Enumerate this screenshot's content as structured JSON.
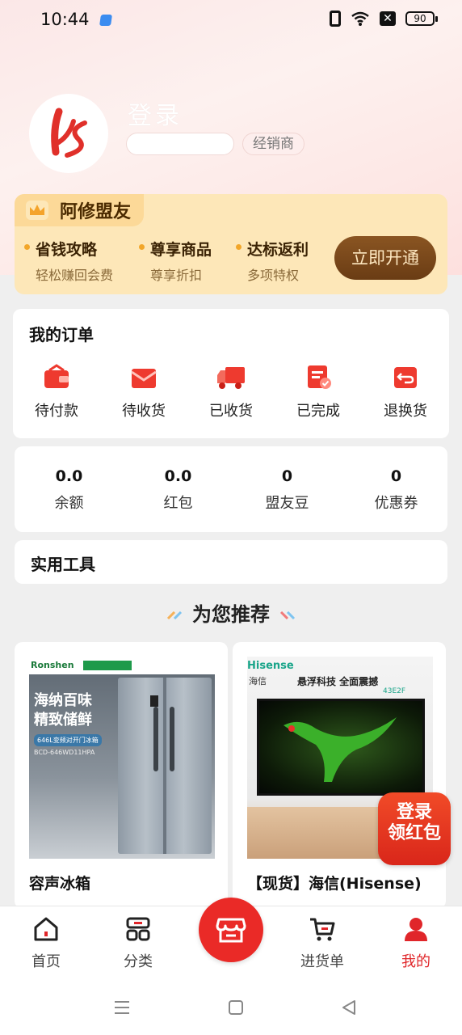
{
  "status_bar": {
    "time": "10:44",
    "battery": "90"
  },
  "profile": {
    "login_text": "登录",
    "dealer_tag": "经销商"
  },
  "membership": {
    "title": "阿修盟友",
    "perks": [
      {
        "title": "省钱攻略",
        "subtitle": "轻松赚回会费"
      },
      {
        "title": "尊享商品",
        "subtitle": "尊享折扣"
      },
      {
        "title": "达标返利",
        "subtitle": "多项特权"
      }
    ],
    "open_button": "立即开通"
  },
  "orders": {
    "title": "我的订单",
    "items": [
      {
        "label": "待付款",
        "icon": "wallet-icon"
      },
      {
        "label": "待收货",
        "icon": "package-icon"
      },
      {
        "label": "已收货",
        "icon": "truck-icon"
      },
      {
        "label": "已完成",
        "icon": "document-check-icon"
      },
      {
        "label": "退换货",
        "icon": "return-icon"
      }
    ]
  },
  "assets": [
    {
      "value": "0.0",
      "label": "余额"
    },
    {
      "value": "0.0",
      "label": "红包"
    },
    {
      "value": "0",
      "label": "盟友豆"
    },
    {
      "value": "0",
      "label": "优惠券"
    }
  ],
  "tools": {
    "title": "实用工具"
  },
  "recommend": {
    "title": "为您推荐"
  },
  "products": [
    {
      "name": "容声冰箱",
      "brand": "Ronshen",
      "banner": [
        "海纳百味",
        "精致储鲜"
      ],
      "model": "BCD-646WD11HPA",
      "spec": "646L变频对开门冰箱"
    },
    {
      "name": "【现货】海信(Hisense)",
      "brand": "Hisense",
      "brand_cn": "海信",
      "headline": "悬浮科技 全面震撼",
      "model": "43E2F"
    }
  ],
  "floating": {
    "red_packet": [
      "登录",
      "领红包"
    ]
  },
  "tabbar": {
    "items": [
      {
        "label": "首页",
        "icon": "home-icon"
      },
      {
        "label": "分类",
        "icon": "category-icon"
      },
      {
        "label": "进货单",
        "icon": "cart-icon"
      },
      {
        "label": "我的",
        "icon": "user-icon"
      }
    ],
    "center_icon": "store-icon"
  },
  "colors": {
    "accent": "#e0262a",
    "gold": "#fcd998",
    "brown": "#7a4719"
  }
}
